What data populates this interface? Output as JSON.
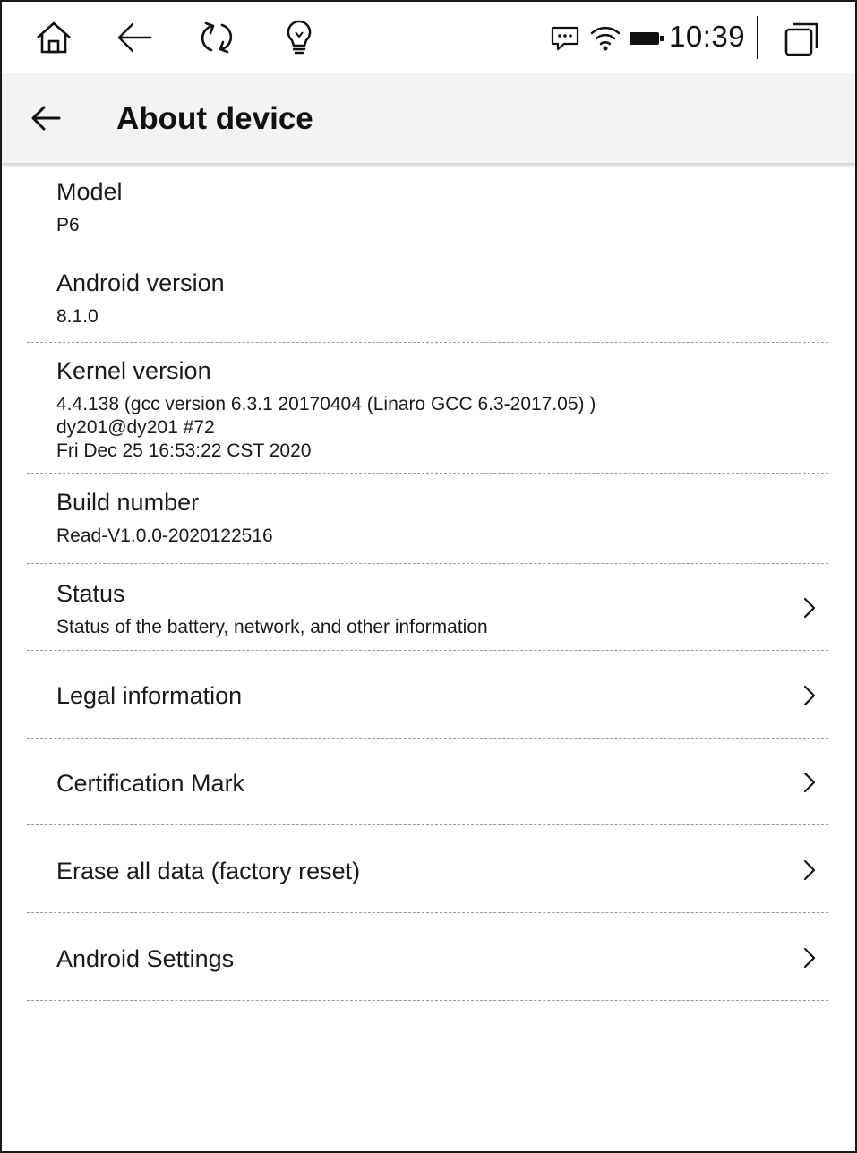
{
  "status_bar": {
    "time": "10:39",
    "icons": [
      "home-icon",
      "back-arrow-icon",
      "refresh-icon",
      "lightbulb-icon",
      "message-icon",
      "wifi-icon",
      "battery-icon",
      "recent-apps-icon"
    ]
  },
  "header": {
    "title": "About device",
    "back_icon": "back-arrow-icon"
  },
  "items": [
    {
      "label": "Model",
      "value": "P6"
    },
    {
      "label": "Android version",
      "value": "8.1.0"
    },
    {
      "label": "Kernel version",
      "value_lines": [
        "4.4.138 (gcc version 6.3.1 20170404 (Linaro GCC 6.3-2017.05) )",
        "dy201@dy201 #72",
        "Fri Dec 25 16:53:22 CST 2020"
      ]
    },
    {
      "label": "Build number",
      "value": "Read-V1.0.0-2020122516"
    },
    {
      "label": "Status",
      "value": "Status of the battery, network, and other information",
      "icon": "chevron-right-icon"
    },
    {
      "label": "Legal information",
      "icon": "chevron-right-icon"
    },
    {
      "label": "Certification Mark",
      "icon": "chevron-right-icon"
    },
    {
      "label": "Erase all data (factory reset)",
      "icon": "chevron-right-icon"
    },
    {
      "label": "Android Settings",
      "icon": "chevron-right-icon"
    }
  ]
}
